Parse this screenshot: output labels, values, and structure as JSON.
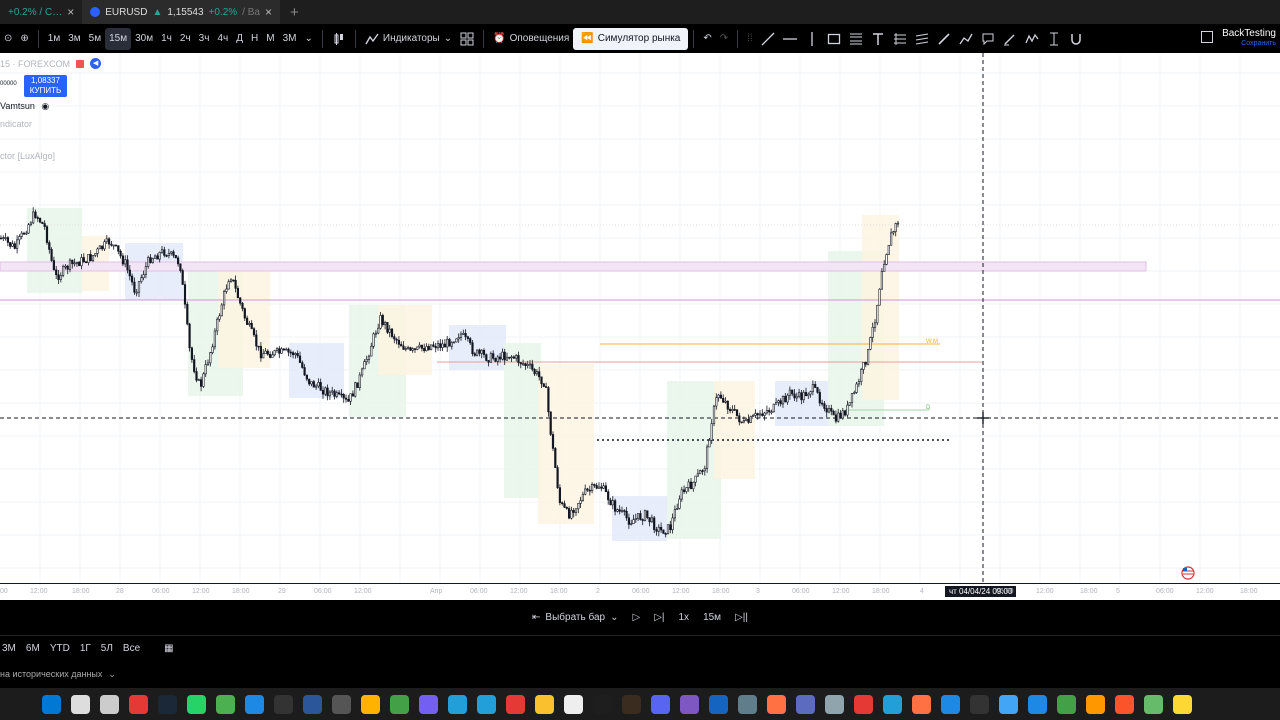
{
  "browser_tabs": [
    {
      "label": "+0.2% / C…",
      "active": false
    },
    {
      "label": "EURUSD",
      "price": "1,15543",
      "change": "+0.2%",
      "suffix": "/ Ba",
      "active": true
    }
  ],
  "toolbar": {
    "timeframes": [
      "1м",
      "3м",
      "5м",
      "15м",
      "30м",
      "1ч",
      "2ч",
      "3ч",
      "4ч",
      "Д",
      "Н",
      "М",
      "3М"
    ],
    "selected_timeframe": "15м",
    "indicators_label": "Индикаторы",
    "alerts_label": "Оповещения",
    "simulator_label": "Симулятор рынка",
    "brand_name": "BackTesting",
    "brand_status": "Сохранить"
  },
  "legend": {
    "symbol_line": "15 · FOREXCOM",
    "bid_prefix": "00000",
    "buy_price": "1,08337",
    "buy_label": "КУПИТЬ",
    "indicator_1": "Vamtsun",
    "indicator_2": "ndicator",
    "indicator_3": "ctor [LuxAlgo]"
  },
  "chart_data": {
    "type": "candlestick",
    "symbol": "EURUSD",
    "timeframe": "15м",
    "crosshair_time": "чт 04/04/24   09:00",
    "time_ticks": [
      "00",
      "12:00",
      "18:00",
      "28",
      "06:00",
      "12:00",
      "18:00",
      "29",
      "06:00",
      "12:00",
      "Апр",
      "06:00",
      "12:00",
      "18:00",
      "2",
      "06:00",
      "12:00",
      "18:00",
      "3",
      "06:00",
      "12:00",
      "18:00",
      "4",
      "06:00",
      "12:00",
      "18:00",
      "5",
      "06:00",
      "12:00",
      "18:00",
      "8"
    ],
    "annotations": [
      "W.M",
      "D"
    ],
    "colors": {
      "bull": "#131722",
      "bear": "#131722",
      "green_zone": "#e8f5e9",
      "orange_zone": "#fdf3e1",
      "blue_zone": "#e3eafa"
    }
  },
  "replay": {
    "select_bar_label": "Выбрать бар",
    "speed": "1x",
    "interval": "15м"
  },
  "ranges": [
    "3М",
    "6М",
    "YTD",
    "1Г",
    "5Л",
    "Все"
  ],
  "status_text": "на исторических данных",
  "taskbar_icons": [
    "windows-icon",
    "search-icon",
    "files-icon",
    "app-red-icon",
    "steam-icon",
    "whatsapp-icon",
    "calculator-icon",
    "save-icon",
    "terminal-icon",
    "image-icon",
    "chrome-spinner-icon",
    "folder-icon",
    "spreadsheet-icon",
    "viber-icon",
    "telegram-icon",
    "telegram-2-icon",
    "opera-icon",
    "chrome-icon",
    "notion-icon",
    "tradingview-icon",
    "bridge-icon",
    "discord-icon",
    "app-purple-icon",
    "app-blue-x-icon",
    "mail-icon",
    "app-orange-icon",
    "app-circle-icon",
    "settings-icon",
    "yandex-icon",
    "telegram-3-icon",
    "game-icon",
    "vscode-icon",
    "app-dark-icon",
    "app-blue-icon",
    "browser-icon",
    "app-green-icon",
    "cloud-icon",
    "brave-icon",
    "app-green-2-icon",
    "app-yellow-icon"
  ]
}
